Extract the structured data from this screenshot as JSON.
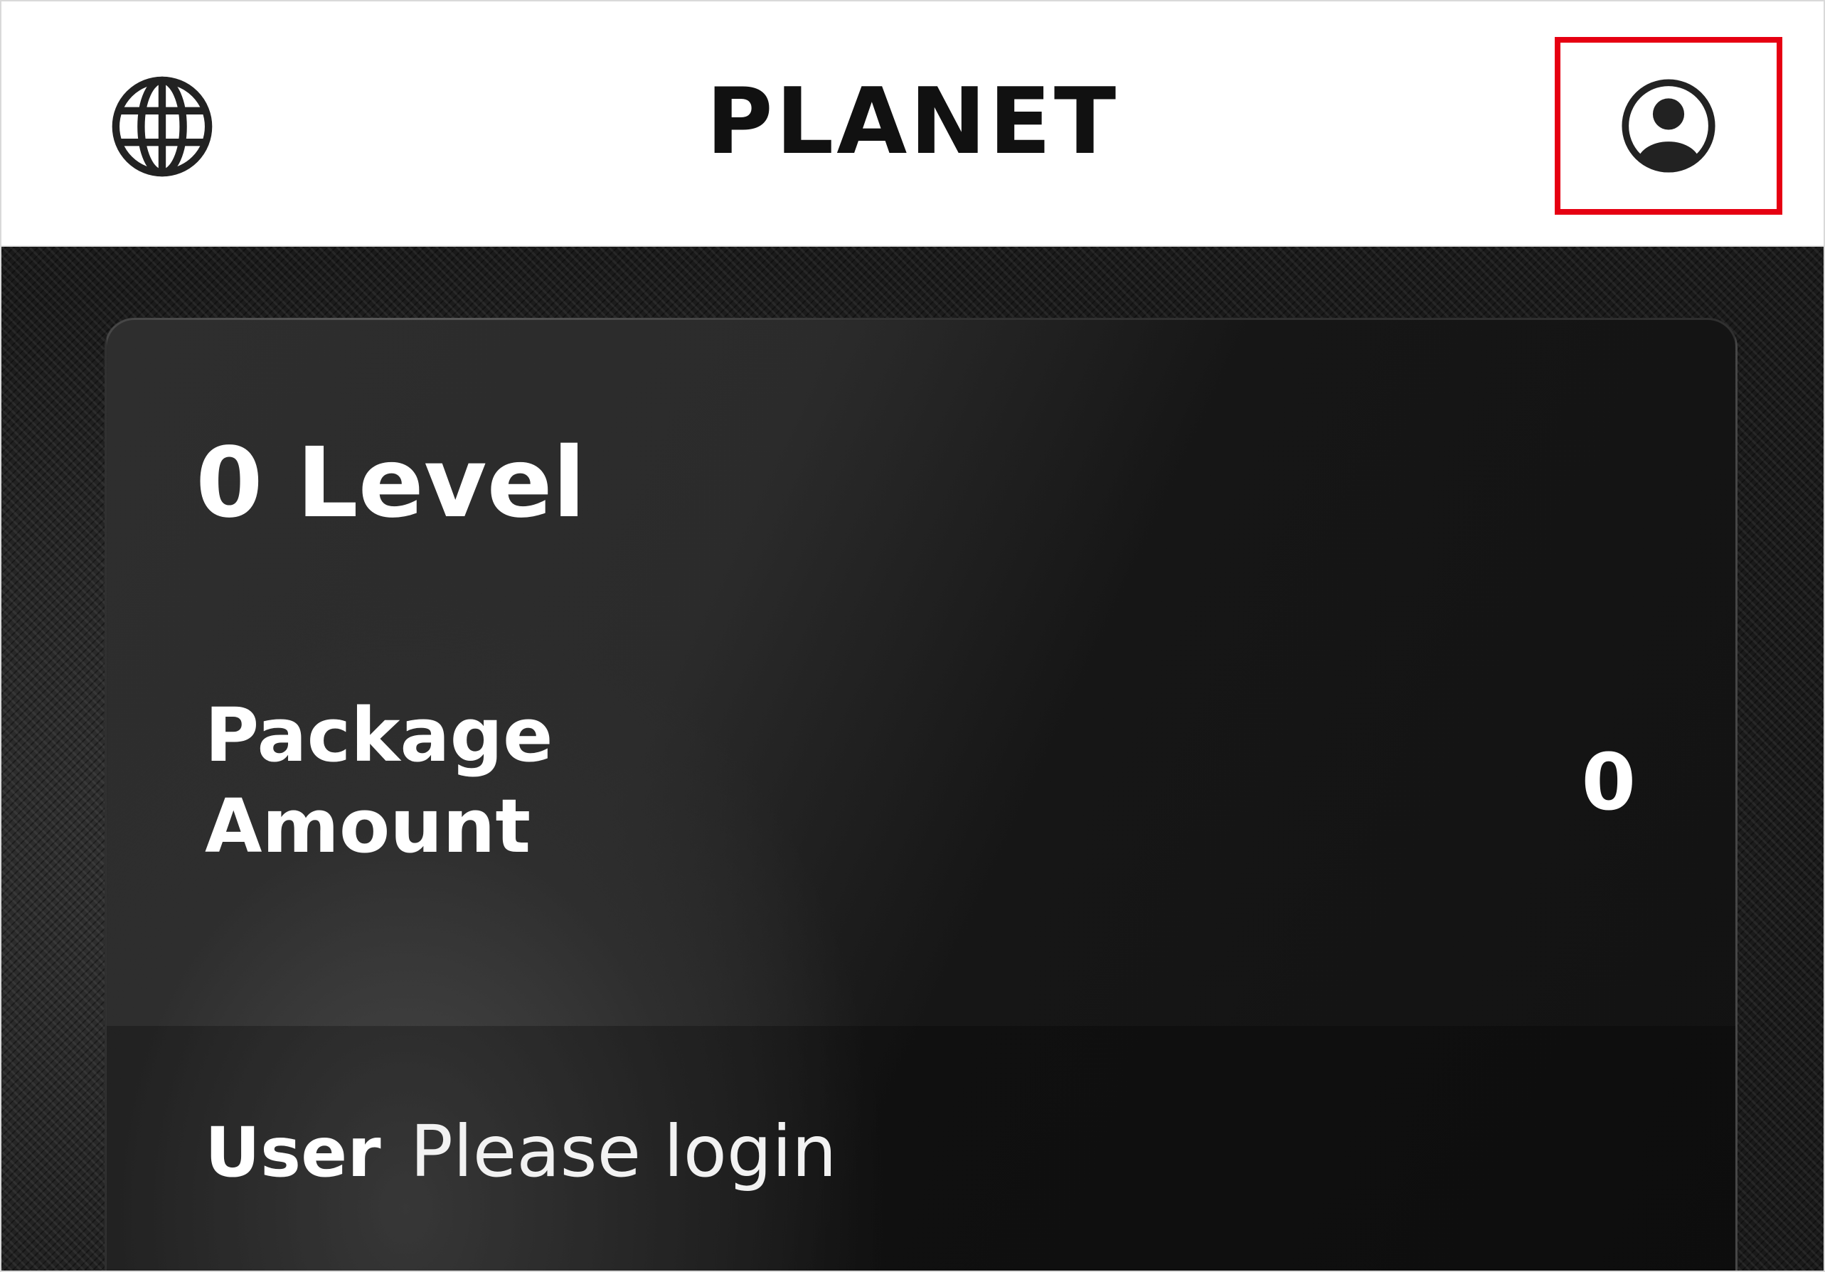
{
  "header": {
    "title": "PLANET",
    "language_icon": "globe-icon",
    "account_icon": "user-circle-icon"
  },
  "card": {
    "level_text": "0 Level",
    "package_label": "Package Amount",
    "package_value": "0",
    "user_label": "User",
    "user_value": "Please login"
  },
  "colors": {
    "highlight_border": "#e60012",
    "card_background": "#1f1f1f",
    "text_primary": "#ffffff",
    "header_background": "#ffffff",
    "title_color": "#111111"
  }
}
